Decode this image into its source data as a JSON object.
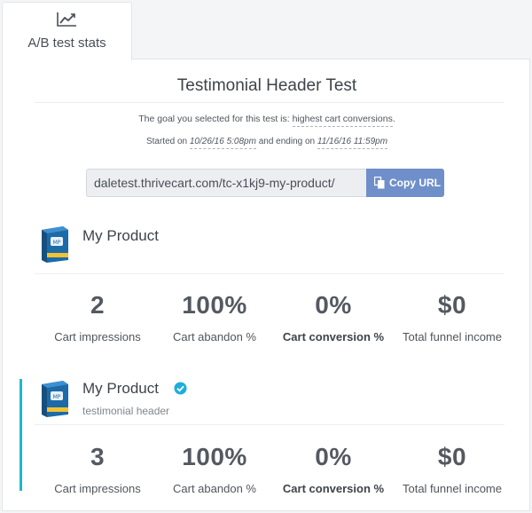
{
  "tab": {
    "label": "A/B test stats",
    "icon": "trend-chart-icon"
  },
  "test": {
    "title": "Testimonial Header Test",
    "goal_prefix": "The goal you selected for this test is: ",
    "goal_value": "highest cart conversions",
    "goal_suffix": ".",
    "started_prefix": "Started on ",
    "start_date": "10/26/16 5:08pm",
    "ending_text": " and ending on ",
    "end_date": "11/16/16 11:59pm",
    "url": "daletest.thrivecart.com/tc-x1kj9-my-product/",
    "copy_label": "Copy URL"
  },
  "variants": [
    {
      "name": "My Product",
      "subtitle": "",
      "stats": [
        {
          "value": "2",
          "label": "Cart impressions"
        },
        {
          "value": "100%",
          "label": "Cart abandon %"
        },
        {
          "value": "0%",
          "label": "Cart conversion %"
        },
        {
          "value": "$0",
          "label": "Total funnel income"
        }
      ]
    },
    {
      "name": "My Product",
      "subtitle": "testimonial header",
      "stats": [
        {
          "value": "3",
          "label": "Cart impressions"
        },
        {
          "value": "100%",
          "label": "Cart abandon %"
        },
        {
          "value": "0%",
          "label": "Cart conversion %"
        },
        {
          "value": "$0",
          "label": "Total funnel income"
        }
      ]
    }
  ],
  "colors": {
    "accent": "#1eb8c8",
    "button": "#6f8fca",
    "check": "#1eaedb"
  }
}
